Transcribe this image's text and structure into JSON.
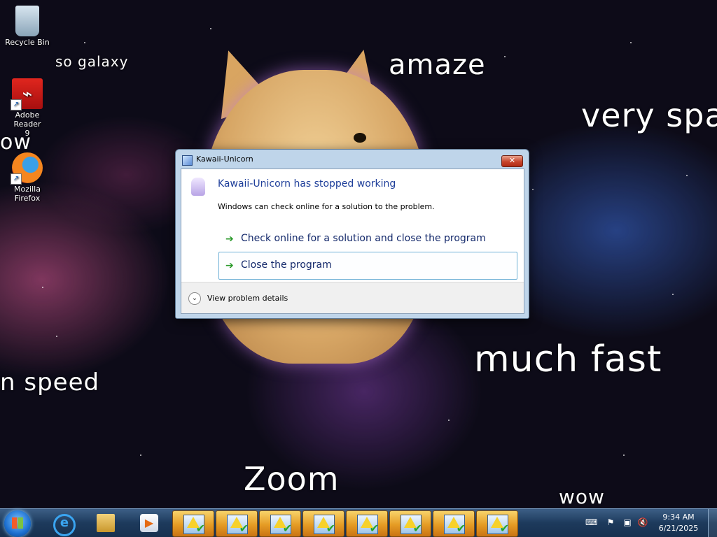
{
  "desktop": {
    "icons": [
      {
        "label": "Recycle Bin",
        "icon": "recycle-bin-icon"
      },
      {
        "label": "Adobe Reader\n9",
        "icon": "adobe-reader-icon"
      },
      {
        "label": "Mozilla\nFirefox",
        "icon": "firefox-icon"
      }
    ],
    "meme_text": {
      "so_galaxy": "so galaxy",
      "amaze": "amaze",
      "very_spa": "very spa",
      "ow": "ow",
      "m_speed": "n speed",
      "much_fast": "much fast",
      "zoom": "Zoom",
      "wow": "wow"
    }
  },
  "dialog": {
    "title": "Kawaii-Unicorn",
    "close_glyph": "✕",
    "heading": "Kawaii-Unicorn has stopped working",
    "subtext": "Windows can check online for a solution to the problem.",
    "options": [
      {
        "label": "Check online for a solution and close the program"
      },
      {
        "label": "Close the program"
      }
    ],
    "details_label": "View problem details"
  },
  "taskbar": {
    "pinned": [
      "internet-explorer-icon",
      "windows-explorer-icon",
      "media-player-icon"
    ],
    "task_buttons_count": 8,
    "clock": {
      "time": "9:34 AM",
      "date": "6/21/2025"
    }
  }
}
